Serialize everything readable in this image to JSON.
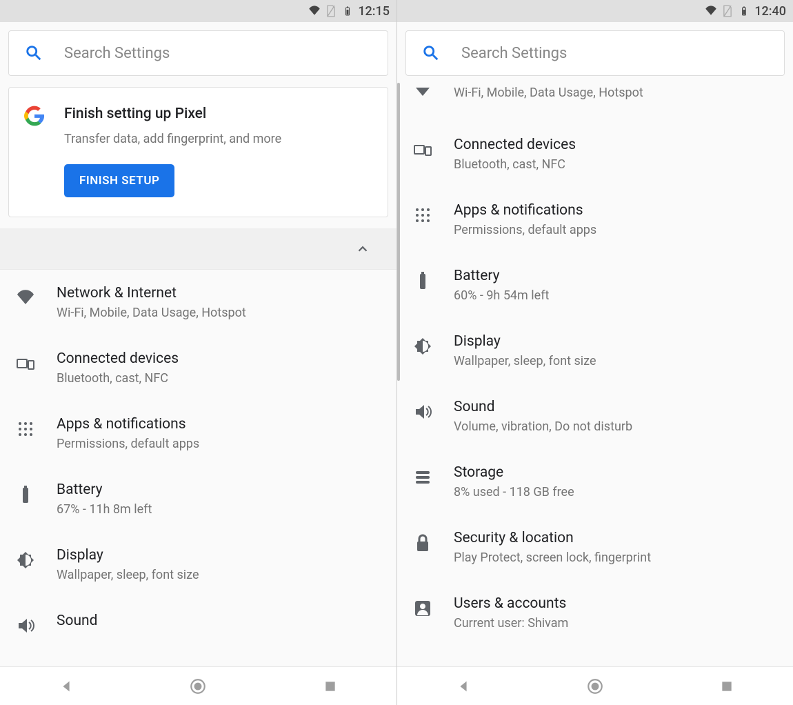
{
  "left": {
    "status_time": "12:15",
    "search_placeholder": "Search Settings",
    "setup": {
      "title": "Finish setting up Pixel",
      "subtitle": "Transfer data, add fingerprint, and more",
      "button": "FINISH SETUP"
    },
    "items": [
      {
        "icon": "wifi",
        "title": "Network & Internet",
        "sub": "Wi-Fi, Mobile, Data Usage, Hotspot"
      },
      {
        "icon": "devices",
        "title": "Connected devices",
        "sub": "Bluetooth, cast, NFC"
      },
      {
        "icon": "apps",
        "title": "Apps & notifications",
        "sub": "Permissions, default apps"
      },
      {
        "icon": "battery",
        "title": "Battery",
        "sub": "67% - 11h 8m left"
      },
      {
        "icon": "display",
        "title": "Display",
        "sub": "Wallpaper, sleep, font size"
      },
      {
        "icon": "sound",
        "title": "Sound",
        "sub": ""
      }
    ]
  },
  "right": {
    "status_time": "12:40",
    "search_placeholder": "Search Settings",
    "items": [
      {
        "icon": "wifi-down",
        "title": "",
        "sub": "Wi-Fi, Mobile, Data Usage, Hotspot"
      },
      {
        "icon": "devices",
        "title": "Connected devices",
        "sub": "Bluetooth, cast, NFC"
      },
      {
        "icon": "apps",
        "title": "Apps & notifications",
        "sub": "Permissions, default apps"
      },
      {
        "icon": "battery",
        "title": "Battery",
        "sub": "60% - 9h 54m left"
      },
      {
        "icon": "display",
        "title": "Display",
        "sub": "Wallpaper, sleep, font size"
      },
      {
        "icon": "sound",
        "title": "Sound",
        "sub": "Volume, vibration, Do not disturb"
      },
      {
        "icon": "storage",
        "title": "Storage",
        "sub": "8% used - 118 GB free"
      },
      {
        "icon": "lock",
        "title": "Security & location",
        "sub": "Play Protect, screen lock, fingerprint"
      },
      {
        "icon": "account",
        "title": "Users & accounts",
        "sub": "Current user: Shivam"
      }
    ]
  }
}
